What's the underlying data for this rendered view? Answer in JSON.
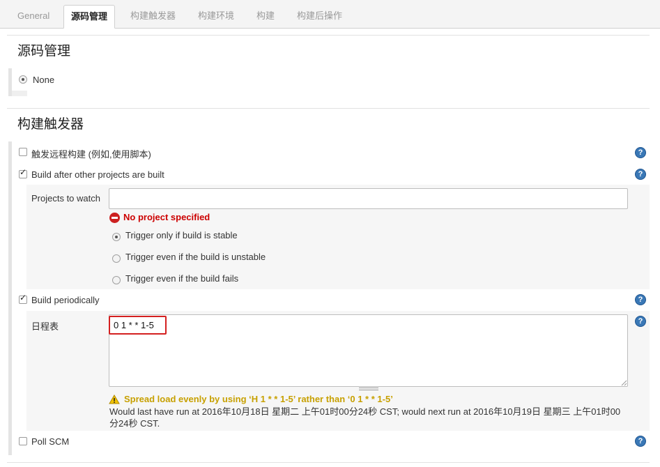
{
  "tabs": [
    {
      "label": "General",
      "active": false
    },
    {
      "label": "源码管理",
      "active": true
    },
    {
      "label": "构建触发器",
      "active": false
    },
    {
      "label": "构建环境",
      "active": false
    },
    {
      "label": "构建",
      "active": false
    },
    {
      "label": "构建后操作",
      "active": false
    }
  ],
  "scm": {
    "title": "源码管理",
    "none_label": "None"
  },
  "triggers": {
    "title": "构建触发器",
    "remote_label": "触发远程构建 (例如,使用脚本)",
    "after_other_label": "Build after other projects are built",
    "projects_to_watch_label": "Projects to watch",
    "projects_to_watch_value": "",
    "error_text": "No project specified",
    "trigger_stable": "Trigger only if build is stable",
    "trigger_unstable": "Trigger even if the build is unstable",
    "trigger_fails": "Trigger even if the build fails",
    "periodic_label": "Build periodically",
    "schedule_label": "日程表",
    "schedule_value": "0 1 * *  1-5",
    "warning_text": "Spread load evenly by using ‘H 1 * *  1-5’ rather than ‘0 1 * *  1-5’",
    "info_text": "Would last have run at 2016年10月18日 星期二 上午01时00分24秒 CST; would next run at 2016年10月19日 星期三 上午01时00分24秒 CST.",
    "poll_scm_label": "Poll SCM"
  },
  "help_glyph": "?",
  "colors": {
    "error": "#cc0000",
    "warning": "#c7a000",
    "help": "#3a78b6",
    "highlight": "#d42020"
  }
}
